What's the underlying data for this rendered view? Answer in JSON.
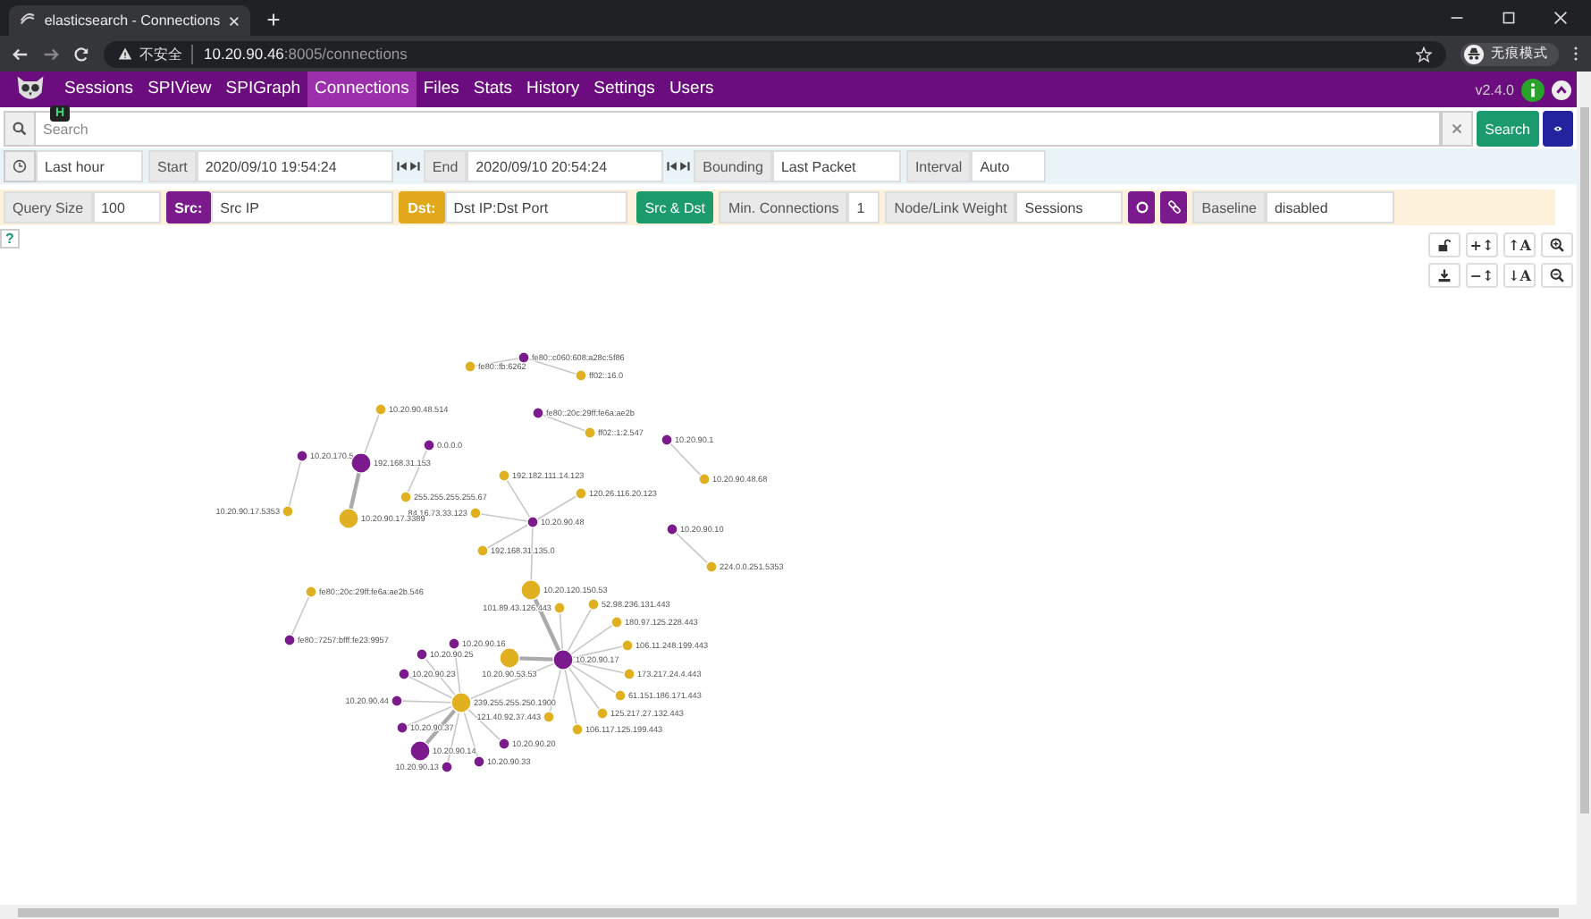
{
  "browser": {
    "tab_title": "elasticsearch - Connections",
    "security": "不安全",
    "url_host": "10.20.90.46",
    "url_rest": ":8005/connections",
    "profile": "无痕模式"
  },
  "nav": {
    "badge": "H",
    "items": [
      {
        "label": "Sessions",
        "selected": false
      },
      {
        "label": "SPIView",
        "selected": false
      },
      {
        "label": "SPIGraph",
        "selected": false
      },
      {
        "label": "Connections",
        "selected": true
      },
      {
        "label": "Files",
        "selected": false
      },
      {
        "label": "Stats",
        "selected": false
      },
      {
        "label": "History",
        "selected": false
      },
      {
        "label": "Settings",
        "selected": false
      },
      {
        "label": "Users",
        "selected": false
      }
    ],
    "version": "v2.4.0"
  },
  "search": {
    "placeholder": "Search",
    "button": "Search"
  },
  "time": {
    "range": "Last hour",
    "start_label": "Start",
    "start": "2020/09/10 19:54:24",
    "end_label": "End",
    "end": "2020/09/10 20:54:24",
    "bounding_label": "Bounding",
    "bounding": "Last Packet",
    "interval_label": "Interval",
    "interval": "Auto"
  },
  "options": {
    "query_size_label": "Query Size",
    "query_size": "100",
    "src_label": "Src:",
    "src": "Src IP",
    "dst_label": "Dst:",
    "dst": "Dst IP:Dst Port",
    "src_dst_button": "Src & Dst",
    "min_connections_label": "Min. Connections",
    "min_connections": "1",
    "weight_label": "Node/Link Weight",
    "weight": "Sessions",
    "baseline_label": "Baseline",
    "baseline": "disabled"
  },
  "help": "?",
  "graph_controls": [
    {
      "kind": "unlock"
    },
    {
      "kind": "text",
      "label": "+↕"
    },
    {
      "kind": "text",
      "label": "↑A"
    },
    {
      "kind": "zoom-in"
    },
    {
      "kind": "download"
    },
    {
      "kind": "text",
      "label": "−↕"
    },
    {
      "kind": "text",
      "label": "↓A"
    },
    {
      "kind": "zoom-out"
    }
  ],
  "graph": {
    "nodes": [
      {
        "label": "fe80::c060:608:a28c:5f86",
        "color": "#7a1a8c",
        "large": false
      },
      {
        "label": "fe80::fb:6262",
        "color": "#e0b020",
        "large": false
      },
      {
        "label": "ff02::16.0",
        "color": "#e0b020",
        "large": false
      },
      {
        "label": "10.20.90.48.514",
        "color": "#e0b020",
        "large": false
      },
      {
        "label": "fe80::20c:29ff:fe6a:ae2b",
        "color": "#7a1a8c",
        "large": false
      },
      {
        "label": "ff02::1:2.547",
        "color": "#e0b020",
        "large": false
      },
      {
        "label": "10.20.90.1",
        "color": "#7a1a8c",
        "large": false
      },
      {
        "label": "0.0.0.0",
        "color": "#7a1a8c",
        "large": false
      },
      {
        "label": "10.20.170.5",
        "color": "#7a1a8c",
        "large": false
      },
      {
        "label": "192.168.31.153",
        "color": "#7a1a8c",
        "large": true
      },
      {
        "label": "192.182.111.14.123",
        "color": "#e0b020",
        "large": false
      },
      {
        "label": "10.20.90.48.68",
        "color": "#e0b020",
        "large": false
      },
      {
        "label": "120.26.116.20.123",
        "color": "#e0b020",
        "large": false
      },
      {
        "label": "255.255.255.255.67",
        "color": "#e0b020",
        "large": false
      },
      {
        "label": "10.20.90.17.5353",
        "color": "#e0b020",
        "large": false
      },
      {
        "label": "84.16.73.33.123",
        "color": "#e0b020",
        "large": false
      },
      {
        "label": "10.20.90.17.3389",
        "color": "#e0b020",
        "large": true
      },
      {
        "label": "10.20.90.48",
        "color": "#7a1a8c",
        "large": false
      },
      {
        "label": "10.20.90.10",
        "color": "#7a1a8c",
        "large": false
      },
      {
        "label": "192.168.31.135.0",
        "color": "#e0b020",
        "large": false
      },
      {
        "label": "224.0.0.251.5353",
        "color": "#e0b020",
        "large": false
      },
      {
        "label": "10.20.120.150.53",
        "color": "#e0b020",
        "large": true
      },
      {
        "label": "fe80::20c:29ff:fe6a:ae2b.546",
        "color": "#e0b020",
        "large": false
      },
      {
        "label": "101.89.43.126.443",
        "color": "#e0b020",
        "large": false
      },
      {
        "label": "52.98.236.131.443",
        "color": "#e0b020",
        "large": false
      },
      {
        "label": "180.97.125.228.443",
        "color": "#e0b020",
        "large": false
      },
      {
        "label": "fe80::7257:bfff:fe23:9957",
        "color": "#7a1a8c",
        "large": false
      },
      {
        "label": "10.20.90.16",
        "color": "#7a1a8c",
        "large": false
      },
      {
        "label": "106.11.248.199.443",
        "color": "#e0b020",
        "large": false
      },
      {
        "label": "10.20.90.25",
        "color": "#7a1a8c",
        "large": false
      },
      {
        "label": "10.20.90.53.53",
        "color": "#e0b020",
        "large": true
      },
      {
        "label": "10.20.90.17",
        "color": "#7a1a8c",
        "large": true
      },
      {
        "label": "10.20.90.23",
        "color": "#7a1a8c",
        "large": false
      },
      {
        "label": "173.217.24.4.443",
        "color": "#e0b020",
        "large": false
      },
      {
        "label": "61.151.186.171.443",
        "color": "#e0b020",
        "large": false
      },
      {
        "label": "10.20.90.44",
        "color": "#7a1a8c",
        "large": false
      },
      {
        "label": "239.255.255.250.1900",
        "color": "#e0b020",
        "large": true
      },
      {
        "label": "125.217.27.132.443",
        "color": "#e0b020",
        "large": false
      },
      {
        "label": "121.40.92.37.443",
        "color": "#e0b020",
        "large": false
      },
      {
        "label": "10.20.90.37",
        "color": "#7a1a8c",
        "large": false
      },
      {
        "label": "106.117.125.199.443",
        "color": "#e0b020",
        "large": false
      },
      {
        "label": "10.20.90.20",
        "color": "#7a1a8c",
        "large": false
      },
      {
        "label": "10.20.90.14",
        "color": "#7a1a8c",
        "large": true
      },
      {
        "label": "10.20.90.13",
        "color": "#7a1a8c",
        "large": false
      },
      {
        "label": "10.20.90.33",
        "color": "#7a1a8c",
        "large": false
      }
    ]
  }
}
